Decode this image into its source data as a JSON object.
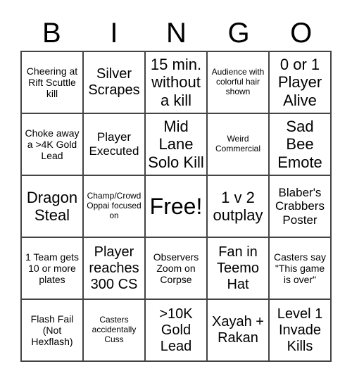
{
  "header": [
    "B",
    "I",
    "N",
    "G",
    "O"
  ],
  "cells": [
    {
      "text": "Cheering at Rift Scuttle kill",
      "size": "s-sm"
    },
    {
      "text": "Silver Scrapes",
      "size": "s-lg"
    },
    {
      "text": "15 min. without a kill",
      "size": "s-xl"
    },
    {
      "text": "Audience with colorful hair shown",
      "size": "s-xs"
    },
    {
      "text": "0 or 1 Player Alive",
      "size": "s-xl"
    },
    {
      "text": "Choke away a >4K Gold Lead",
      "size": "s-sm"
    },
    {
      "text": "Player Executed",
      "size": "s-md"
    },
    {
      "text": "Mid Lane Solo Kill",
      "size": "s-xl"
    },
    {
      "text": "Weird Commercial",
      "size": "s-xs"
    },
    {
      "text": "Sad Bee Emote",
      "size": "s-xl"
    },
    {
      "text": "Dragon Steal",
      "size": "s-xl"
    },
    {
      "text": "Champ/Crowd Oppai focused on",
      "size": "s-xs"
    },
    {
      "text": "Free!",
      "size": "s-xxl"
    },
    {
      "text": "1 v 2 outplay",
      "size": "s-xl"
    },
    {
      "text": "Blaber's Crabbers Poster",
      "size": "s-md"
    },
    {
      "text": "1 Team gets 10 or more plates",
      "size": "s-sm"
    },
    {
      "text": "Player reaches 300 CS",
      "size": "s-lg"
    },
    {
      "text": "Observers Zoom on Corpse",
      "size": "s-sm"
    },
    {
      "text": "Fan in Teemo Hat",
      "size": "s-lg"
    },
    {
      "text": "Casters say \"This game is over\"",
      "size": "s-sm"
    },
    {
      "text": "Flash Fail (Not Hexflash)",
      "size": "s-sm"
    },
    {
      "text": "Casters accidentally Cuss",
      "size": "s-xs"
    },
    {
      "text": ">10K Gold Lead",
      "size": "s-lg"
    },
    {
      "text": "Xayah + Rakan",
      "size": "s-lg"
    },
    {
      "text": "Level 1 Invade Kills",
      "size": "s-lg"
    }
  ]
}
